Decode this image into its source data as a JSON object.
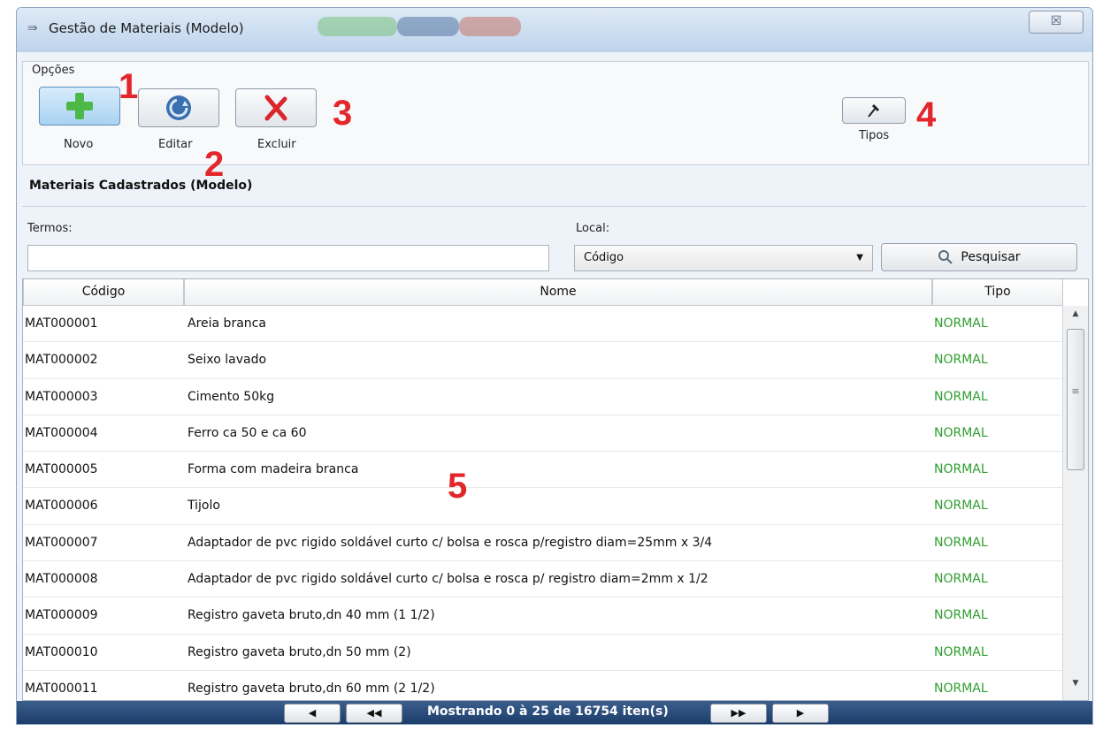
{
  "window": {
    "title": "Gestão de Materiais (Modelo)",
    "close_glyph": "☒"
  },
  "options": {
    "group_label": "Opções",
    "buttons": [
      {
        "label": "Novo",
        "icon": "plus-icon"
      },
      {
        "label": "Editar",
        "icon": "refresh-icon"
      },
      {
        "label": "Excluir",
        "icon": "delete-x-icon"
      },
      {
        "label": "Tipos",
        "icon": "hammer-icon"
      }
    ]
  },
  "annotations": [
    "1",
    "2",
    "3",
    "4",
    "5"
  ],
  "section": {
    "title": "Materiais Cadastrados (Modelo)"
  },
  "search": {
    "terms_label": "Termos:",
    "terms_value": "",
    "local_label": "Local:",
    "local_selected": "Código",
    "button_label": "Pesquisar"
  },
  "grid": {
    "columns": [
      "Código",
      "Nome",
      "Tipo"
    ],
    "rows": [
      {
        "code": "MAT000001",
        "name": "Areia branca",
        "tipo": "NORMAL"
      },
      {
        "code": "MAT000002",
        "name": "Seixo lavado",
        "tipo": "NORMAL"
      },
      {
        "code": "MAT000003",
        "name": "Cimento 50kg",
        "tipo": "NORMAL"
      },
      {
        "code": "MAT000004",
        "name": "Ferro ca 50 e ca 60",
        "tipo": "NORMAL"
      },
      {
        "code": "MAT000005",
        "name": "Forma com madeira branca",
        "tipo": "NORMAL"
      },
      {
        "code": "MAT000006",
        "name": "Tijolo",
        "tipo": "NORMAL"
      },
      {
        "code": "MAT000007",
        "name": "Adaptador de pvc rigido soldável curto c/ bolsa e rosca p/registro diam=25mm x 3/4",
        "tipo": "NORMAL"
      },
      {
        "code": "MAT000008",
        "name": "Adaptador de pvc rigido soldável curto c/ bolsa e rosca p/ registro diam=2mm x 1/2",
        "tipo": "NORMAL"
      },
      {
        "code": "MAT000009",
        "name": "Registro gaveta bruto,dn 40 mm (1 1/2)",
        "tipo": "NORMAL"
      },
      {
        "code": "MAT000010",
        "name": "Registro gaveta bruto,dn 50 mm (2)",
        "tipo": "NORMAL"
      },
      {
        "code": "MAT000011",
        "name": "Registro gaveta bruto,dn 60 mm (2 1/2)",
        "tipo": "NORMAL"
      }
    ]
  },
  "footer": {
    "paging_text": "Mostrando 0 à 25 de 16754 iten(s)",
    "prev": "◀",
    "first": "◀◀",
    "last": "▶▶",
    "next": "▶"
  },
  "colors": {
    "tipo_text": "#2e9e2e",
    "annotation": "#e3262b",
    "footer_bg": "#1a3a66"
  }
}
